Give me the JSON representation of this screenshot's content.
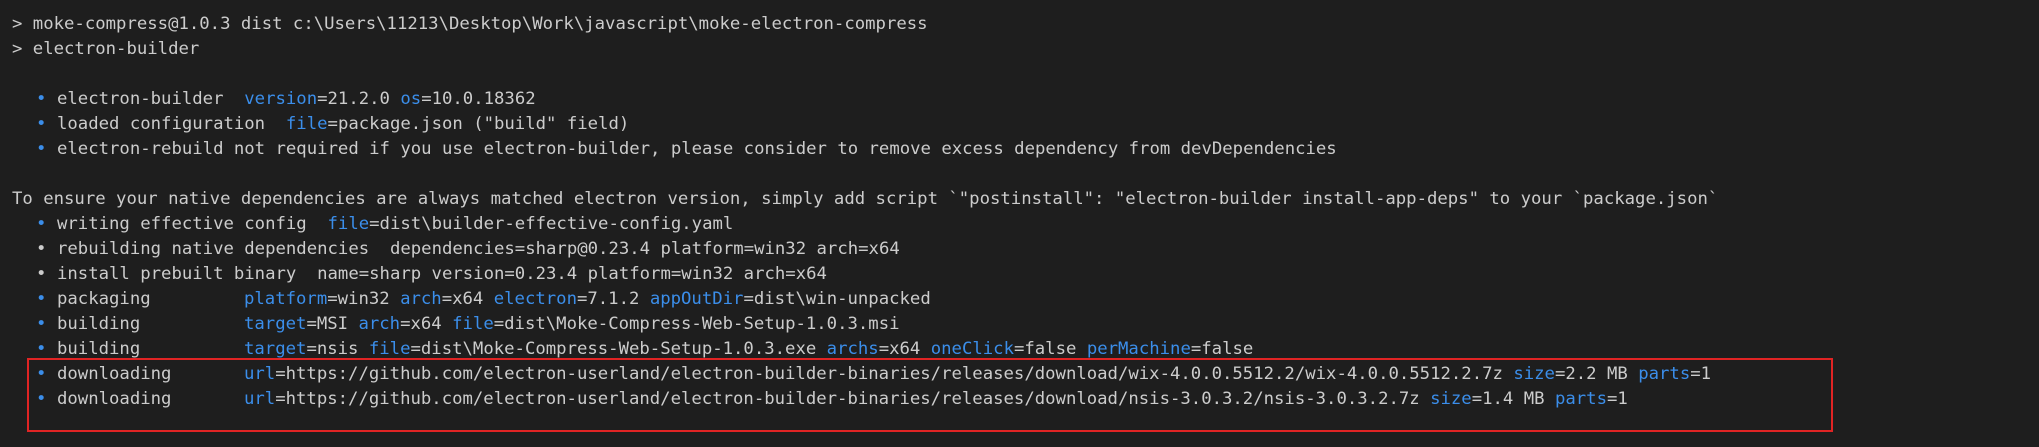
{
  "terminal": {
    "lines": [
      {
        "type": "prompt",
        "text": "> moke-compress@1.0.3 dist c:\\Users\\11213\\Desktop\\Work\\javascript\\moke-electron-compress"
      },
      {
        "type": "prompt",
        "text": "> electron-builder"
      },
      {
        "type": "blank",
        "text": ""
      },
      {
        "type": "bullet",
        "label": "electron-builder",
        "pairs": [
          {
            "k": "version",
            "v": "21.2.0"
          },
          {
            "k": "os",
            "v": "10.0.18362"
          }
        ]
      },
      {
        "type": "bullet",
        "label": "loaded configuration",
        "pairs": [
          {
            "k": "file",
            "v": "package.json (\"build\" field)"
          }
        ]
      },
      {
        "type": "bullet",
        "label": "electron-rebuild not required if you use electron-builder, please consider to remove excess dependency from devDependencies",
        "pairs": []
      },
      {
        "type": "blank",
        "text": ""
      },
      {
        "type": "plain",
        "text": "To ensure your native dependencies are always matched electron version, simply add script `\"postinstall\": \"electron-builder install-app-deps\" to your `package.json`"
      },
      {
        "type": "bullet",
        "label": "writing effective config",
        "pairs": [
          {
            "k": "file",
            "v": "dist\\builder-effective-config.yaml"
          }
        ]
      },
      {
        "type": "bullet-gray",
        "label": "rebuilding native dependencies",
        "text": "dependencies=sharp@0.23.4 platform=win32 arch=x64"
      },
      {
        "type": "bullet-gray",
        "label": "install prebuilt binary",
        "text": "name=sharp version=0.23.4 platform=win32 arch=x64"
      },
      {
        "type": "bullet",
        "label": "packaging",
        "col": true,
        "pairs": [
          {
            "k": "platform",
            "v": "win32"
          },
          {
            "k": "arch",
            "v": "x64"
          },
          {
            "k": "electron",
            "v": "7.1.2"
          },
          {
            "k": "appOutDir",
            "v": "dist\\win-unpacked"
          }
        ]
      },
      {
        "type": "bullet",
        "label": "building",
        "col": true,
        "pairs": [
          {
            "k": "target",
            "v": "MSI"
          },
          {
            "k": "arch",
            "v": "x64"
          },
          {
            "k": "file",
            "v": "dist\\Moke-Compress-Web-Setup-1.0.3.msi"
          }
        ]
      },
      {
        "type": "bullet",
        "label": "building",
        "col": true,
        "pairs": [
          {
            "k": "target",
            "v": "nsis"
          },
          {
            "k": "file",
            "v": "dist\\Moke-Compress-Web-Setup-1.0.3.exe"
          },
          {
            "k": "archs",
            "v": "x64"
          },
          {
            "k": "oneClick",
            "v": "false"
          },
          {
            "k": "perMachine",
            "v": "false"
          }
        ]
      },
      {
        "type": "bullet",
        "label": "downloading",
        "col": true,
        "pairs": [
          {
            "k": "url",
            "v": "https://github.com/electron-userland/electron-builder-binaries/releases/download/wix-4.0.0.5512.2/wix-4.0.0.5512.2.7z"
          },
          {
            "k": "size",
            "v": "2.2 MB"
          },
          {
            "k": "parts",
            "v": "1"
          }
        ]
      },
      {
        "type": "bullet",
        "label": "downloading",
        "col": true,
        "pairs": [
          {
            "k": "url",
            "v": "https://github.com/electron-userland/electron-builder-binaries/releases/download/nsis-3.0.3.2/nsis-3.0.3.2.7z"
          },
          {
            "k": "size",
            "v": "1.4 MB"
          },
          {
            "k": "parts",
            "v": "1"
          }
        ]
      }
    ],
    "bullet_glyph": "•",
    "highlight_color": "#e02424",
    "key_color": "#3b8eea",
    "text_color": "#cccccc",
    "background": "#1e1e1e"
  }
}
